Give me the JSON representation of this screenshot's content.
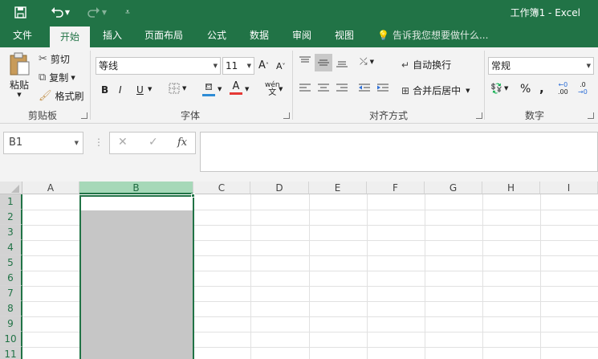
{
  "titlebar": {
    "title": "工作簿1 - Excel",
    "save_icon": "save-icon",
    "undo_icon": "undo-icon",
    "redo_icon": "redo-icon",
    "customize_icon": "customize-qat-icon"
  },
  "tabs": [
    {
      "label": "文件"
    },
    {
      "label": "开始"
    },
    {
      "label": "插入"
    },
    {
      "label": "页面布局"
    },
    {
      "label": "公式"
    },
    {
      "label": "数据"
    },
    {
      "label": "审阅"
    },
    {
      "label": "视图"
    }
  ],
  "active_tab": "开始",
  "tellme": {
    "placeholder": "告诉我您想要做什么..."
  },
  "clipboard": {
    "paste": "粘贴",
    "cut": "剪切",
    "copy": "复制",
    "format_painter": "格式刷",
    "label": "剪贴板"
  },
  "font": {
    "name": "等线",
    "size": "11",
    "grow": "A",
    "shrink": "A",
    "bold": "B",
    "italic": "I",
    "underline": "U",
    "font_color": "A",
    "phonetic": "wén",
    "phonetic_sub": "文",
    "label": "字体"
  },
  "alignment": {
    "wrap_text": "自动换行",
    "merge_center": "合并后居中",
    "label": "对齐方式"
  },
  "number": {
    "format": "常规",
    "percent": "%",
    "comma": ",",
    "label": "数字",
    "inc_decimal": ".00",
    "dec_decimal": ".0"
  },
  "formula_bar": {
    "name_box": "B1",
    "cancel": "✕",
    "enter": "✓",
    "fx": "fx",
    "value": ""
  },
  "columns": [
    "A",
    "B",
    "C",
    "D",
    "E",
    "F",
    "G",
    "H",
    "I"
  ],
  "rows": [
    "1",
    "2",
    "3",
    "4",
    "5",
    "6",
    "7",
    "8",
    "9",
    "10",
    "11"
  ],
  "selected_column": "B",
  "colors": {
    "accent": "#217346",
    "selection_fill": "#c6c6c6",
    "header_selected": "#a6d8b8"
  }
}
